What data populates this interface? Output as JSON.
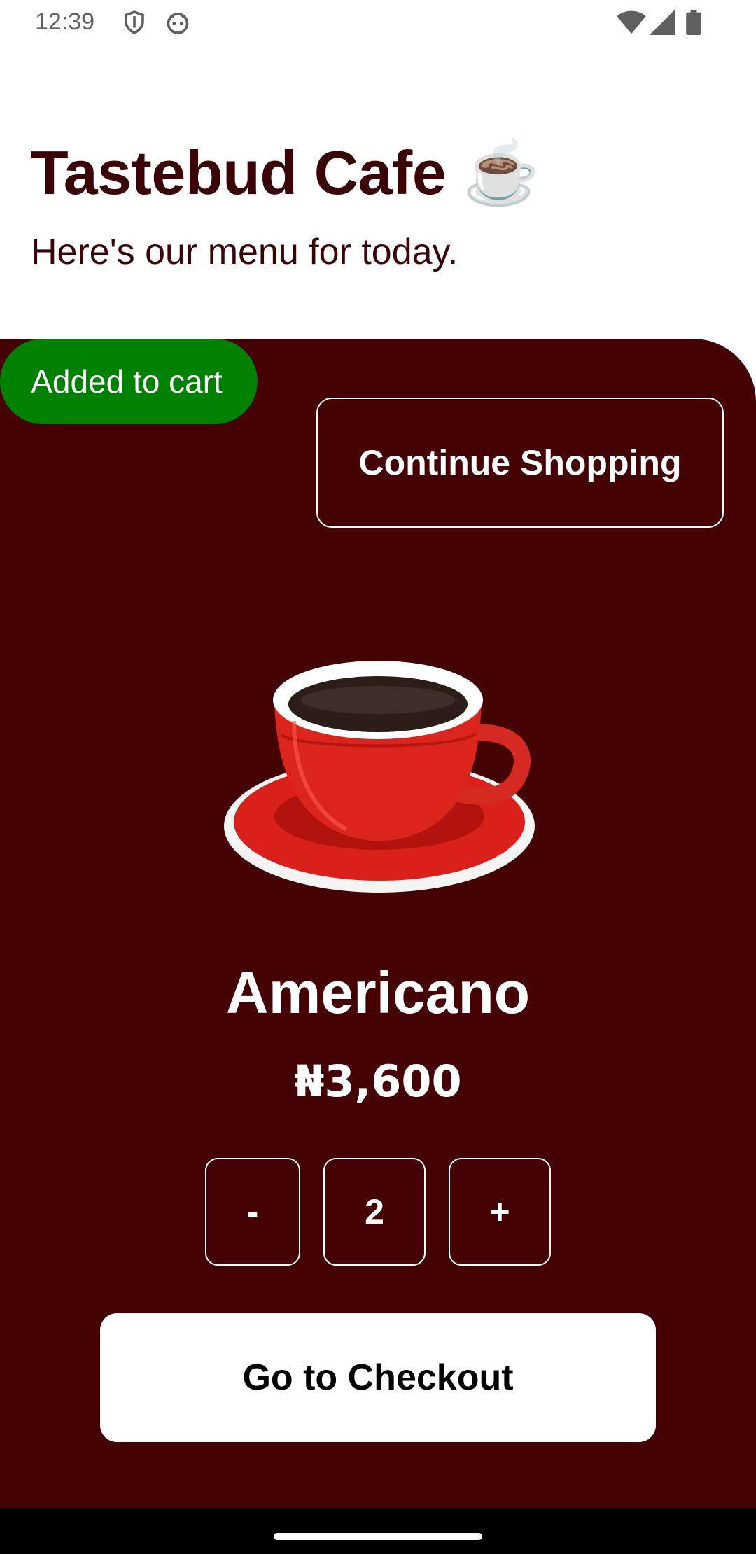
{
  "status_bar": {
    "time": "12:39",
    "left_icons": [
      "shield-icon",
      "android-face-icon"
    ],
    "right_icons": [
      "wifi-icon",
      "signal-icon",
      "battery-icon"
    ]
  },
  "header": {
    "title": "Tastebud Cafe ☕",
    "subtitle": "Here's our menu for today."
  },
  "toast": {
    "text": "Added to cart",
    "color": "#008000"
  },
  "actions": {
    "continue_label": "Continue Shopping",
    "checkout_label": "Go to Checkout"
  },
  "product": {
    "name": "Americano",
    "price": "₦3,600",
    "image": "coffee-cup-image"
  },
  "quantity": {
    "decrement_label": "-",
    "value": "2",
    "increment_label": "+"
  },
  "colors": {
    "brand_dark": "#450205",
    "title_text": "#3a0306",
    "toast_green": "#008000"
  }
}
